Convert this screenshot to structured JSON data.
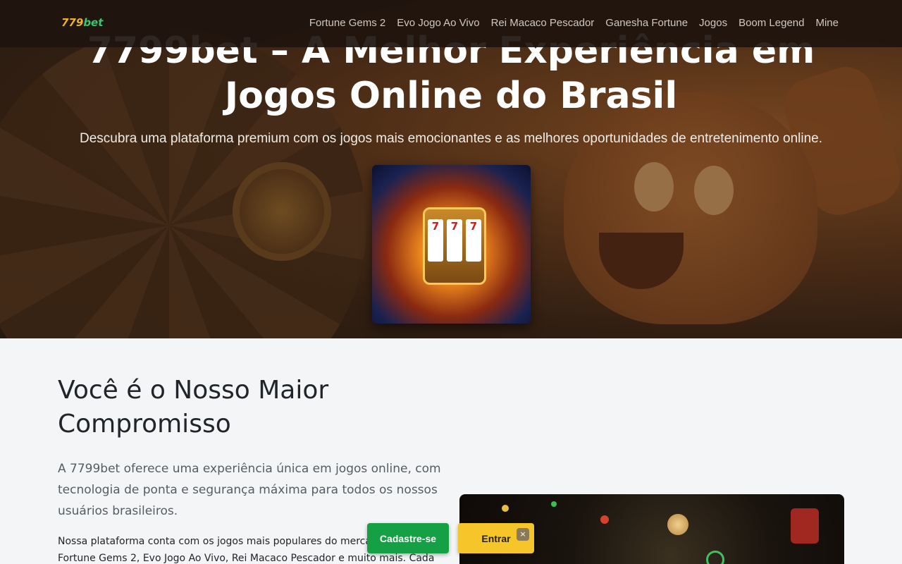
{
  "brand": {
    "prefix": "779",
    "suffix": "bet"
  },
  "nav": {
    "items": [
      {
        "label": "Fortune Gems 2"
      },
      {
        "label": "Evo Jogo Ao Vivo"
      },
      {
        "label": "Rei Macaco Pescador"
      },
      {
        "label": "Ganesha Fortune"
      },
      {
        "label": "Jogos"
      },
      {
        "label": "Boom Legend"
      },
      {
        "label": "Mine"
      }
    ]
  },
  "hero": {
    "title": "7799bet – A Melhor Experiência em Jogos Online do Brasil",
    "subtitle": "Descubra uma plataforma premium com os jogos mais emocionantes e as melhores oportunidades de entretenimento online.",
    "slot_reels": [
      "7",
      "7",
      "7"
    ]
  },
  "section": {
    "title": "Você é o Nosso Maior Compromisso",
    "lead": "A 7799bet oferece uma experiência única em jogos online, com tecnologia de ponta e segurança máxima para todos os nossos usuários brasileiros.",
    "body": "Nossa plataforma conta com os jogos mais populares do mercado como Fortune Gems 2, Evo Jogo Ao Vivo, Rei Macaco Pescador e muito mais. Cada"
  },
  "cta": {
    "signup_label": "Cadastre-se",
    "login_label": "Entrar",
    "close_label": "×"
  },
  "colors": {
    "brand_gold": "#f0b323",
    "brand_green": "#3ec46d",
    "signup_bg": "#15a045",
    "login_bg": "#f5c52a"
  }
}
